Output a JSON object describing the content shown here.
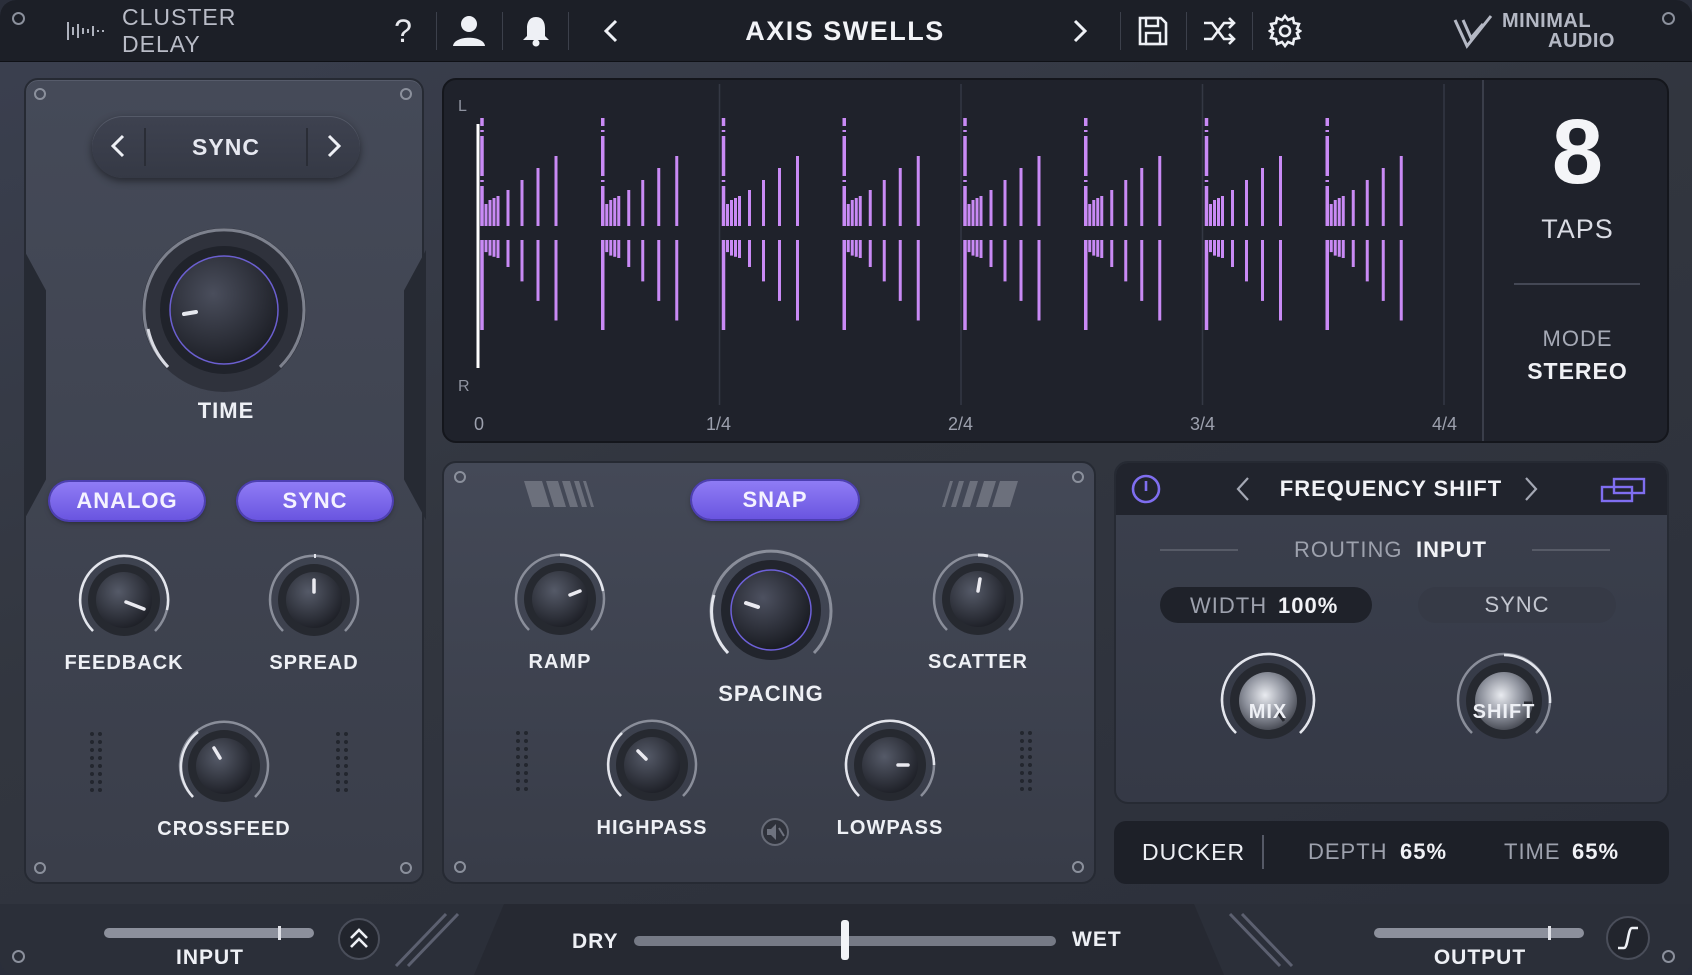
{
  "topbar": {
    "plugin_name": "CLUSTER DELAY",
    "preset_name": "AXIS SWELLS",
    "brand_line1": "MINIMAL",
    "brand_line2": "AUDIO",
    "icons": [
      "waveform-logo-icon",
      "help-icon",
      "user-icon",
      "bell-icon",
      "prev-preset-icon",
      "next-preset-icon",
      "save-icon",
      "shuffle-icon",
      "settings-icon",
      "minimal-audio-logo-icon"
    ]
  },
  "left_panel": {
    "mode_selector": {
      "label": "SYNC",
      "prev": "<",
      "next": ">"
    },
    "time_label": "TIME",
    "analog_button": "ANALOG",
    "sync_button": "SYNC",
    "feedback_label": "FEEDBACK",
    "spread_label": "SPREAD",
    "crossfeed_label": "CROSSFEED"
  },
  "display": {
    "channel_left": "L",
    "channel_right": "R",
    "grid_labels": [
      "0",
      "1/4",
      "2/4",
      "3/4",
      "4/4"
    ],
    "taps_value": "8",
    "taps_label": "TAPS",
    "mode_label": "MODE",
    "mode_value": "STEREO",
    "accent_color": "#c98af5"
  },
  "mid_panel": {
    "snap_button": "SNAP",
    "ramp_label": "RAMP",
    "spacing_label": "SPACING",
    "scatter_label": "SCATTER",
    "highpass_label": "HIGHPASS",
    "lowpass_label": "LOWPASS"
  },
  "fx_panel": {
    "fx_name": "FREQUENCY SHIFT",
    "routing_label": "ROUTING",
    "routing_value": "INPUT",
    "width_label": "WIDTH",
    "width_value": "100%",
    "sync_label": "SYNC",
    "mix_label": "MIX",
    "shift_label": "SHIFT"
  },
  "ducker": {
    "label": "DUCKER",
    "depth_label": "DEPTH",
    "depth_value": "65%",
    "time_label": "TIME",
    "time_value": "65%"
  },
  "bottom": {
    "input_label": "INPUT",
    "dry_label": "DRY",
    "wet_label": "WET",
    "output_label": "OUTPUT",
    "dry_wet_position": 0.5
  }
}
